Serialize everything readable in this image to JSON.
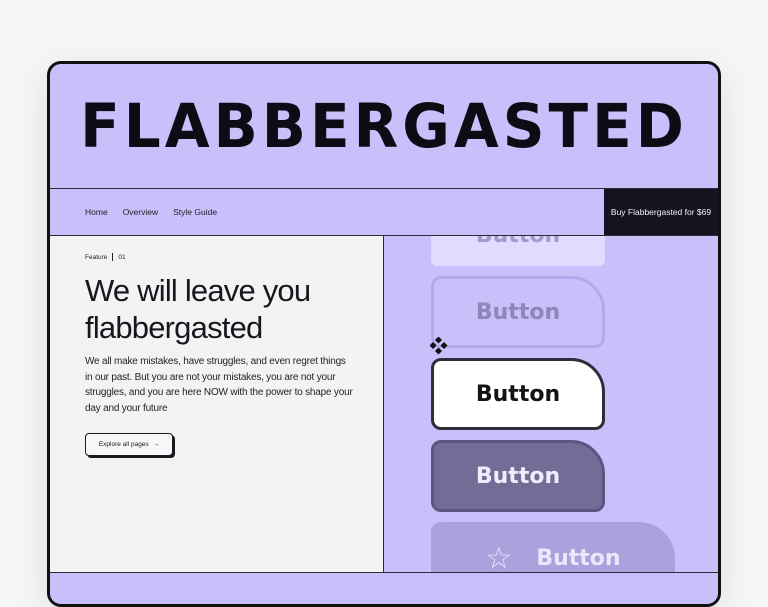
{
  "brand": {
    "title": "FLABBERGASTED"
  },
  "nav": {
    "links": [
      "Home",
      "Overview",
      "Style Guide"
    ],
    "cta": "Buy Flabbergasted for $69"
  },
  "hero": {
    "feature_label": "Feature",
    "feature_number": "01",
    "headline": "We will leave you flabbergasted",
    "body": "We all make mistakes, have struggles, and even regret things in our past. But you are not your mistakes, you are not your struggles, and you are here NOW with the power to shape your day and your future",
    "cta": "Explore all pages",
    "cta_arrow": "→"
  },
  "buttons": {
    "label": "Button",
    "star_icon": "☆"
  },
  "colors": {
    "background": "#c8bffb",
    "dark": "#15131f",
    "panel": "#f3f3f3"
  }
}
